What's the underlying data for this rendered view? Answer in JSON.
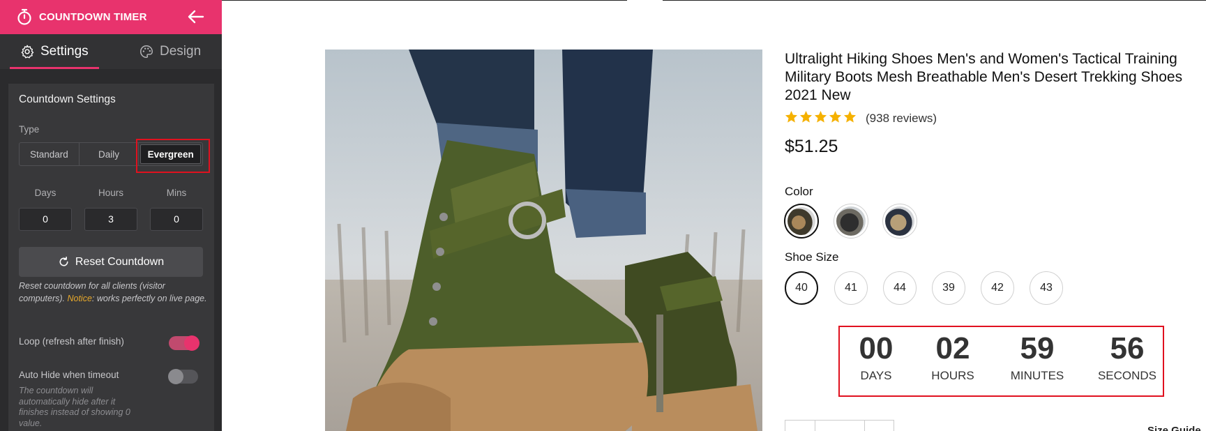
{
  "sidebar": {
    "header": {
      "title": "COUNTDOWN TIMER"
    },
    "tabs": [
      {
        "label": "Settings",
        "active": true
      },
      {
        "label": "Design",
        "active": false
      }
    ],
    "panel": {
      "title": "Countdown Settings",
      "type_label": "Type",
      "type_options": [
        "Standard",
        "Daily",
        "Evergreen"
      ],
      "type_selected": "Evergreen",
      "duration_labels": {
        "days": "Days",
        "hours": "Hours",
        "mins": "Mins"
      },
      "duration_values": {
        "days": "0",
        "hours": "3",
        "mins": "0"
      },
      "reset_label": "Reset Countdown",
      "reset_note_before": "Reset countdown for all clients (visitor computers). ",
      "reset_note_notice": "Notice",
      "reset_note_after": ": works perfectly on live page.",
      "loop_label": "Loop (refresh after finish)",
      "loop_on": true,
      "autohide_label": "Auto Hide when timeout",
      "autohide_on": false,
      "autohide_note": "The countdown will automatically hide after it finishes instead of showing 0 value."
    }
  },
  "product": {
    "title": "Ultralight Hiking Shoes Men's and Women's Tactical Training Military Boots Mesh Breathable Men's Desert Trekking Shoes 2021 New",
    "rating": 5,
    "reviews": "(938 reviews)",
    "price": "$51.25",
    "color_label": "Color",
    "color_selected_index": 0,
    "shoe_size_label": "Shoe Size",
    "sizes": [
      "40",
      "41",
      "44",
      "39",
      "42",
      "43"
    ],
    "size_selected": "40",
    "size_guide_label": "Size Guide"
  },
  "countdown": {
    "days": "00",
    "days_label": "DAYS",
    "hours": "02",
    "hours_label": "HOURS",
    "minutes": "59",
    "minutes_label": "MINUTES",
    "seconds": "56",
    "seconds_label": "SECONDS"
  },
  "colors": {
    "accent": "#e8336d",
    "highlight": "#e0111f",
    "sidebar_bg": "#2b2b2d",
    "notice": "#e6a82b"
  }
}
